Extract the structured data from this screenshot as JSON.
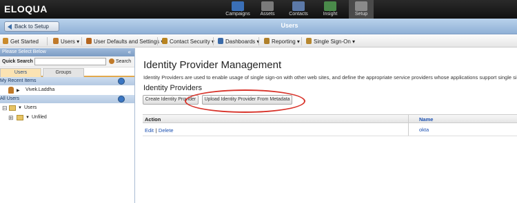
{
  "app": {
    "brand": "ELOQUA"
  },
  "topnav": [
    {
      "label": "Campaigns",
      "color": "#3a6fb7"
    },
    {
      "label": "Assets",
      "color": "#7a7a7a"
    },
    {
      "label": "Contacts",
      "color": "#5c79a8"
    },
    {
      "label": "Insight",
      "color": "#4a8a4a"
    },
    {
      "label": "Setup",
      "color": "#8a8a8a"
    }
  ],
  "titlebar": {
    "back_label": "Back to Setup",
    "title": "Users"
  },
  "menubar": [
    {
      "label": "Get Started",
      "icon": "rocket-icon",
      "color": "#c98a2b"
    },
    {
      "label": "Users ▾",
      "icon": "user-icon",
      "color": "#c07a2a"
    },
    {
      "label": "User Defaults and Settings ▾",
      "icon": "user-gear-icon",
      "color": "#b4651f"
    },
    {
      "label": "Contact Security ▾",
      "icon": "lock-icon",
      "color": "#b8831f"
    },
    {
      "label": "Dashboards ▾",
      "icon": "dashboard-icon",
      "color": "#3a6aa8"
    },
    {
      "label": "Reporting ▾",
      "icon": "report-icon",
      "color": "#b0802a"
    },
    {
      "label": "Single Sign-On ▾",
      "icon": "key-icon",
      "color": "#b7872e"
    }
  ],
  "sidebar": {
    "header": "Please Select Below",
    "collapse": "«",
    "quick_search_label": "Quick Search",
    "search_label": "Search",
    "tabs": [
      "Users",
      "Groups"
    ],
    "recent_title": "My Recent Items",
    "recent_items": [
      "Vivek.Laddha"
    ],
    "all_users_title": "All Users",
    "tree": [
      {
        "label": "Users",
        "expander": "⊟"
      },
      {
        "label": "Unfiled",
        "expander": "⊞"
      }
    ]
  },
  "main": {
    "title": "Identity Provider Management",
    "description": "Identity Providers are used to enable usage of single sign-on with other web sites, and define the appropriate service providers whose applications support single sign-on.",
    "section": "Identity Providers",
    "buttons": {
      "create": "Create Identity Provider",
      "upload": "Upload Identity Provider From Metadata"
    },
    "table": {
      "columns": [
        "Action",
        "Name"
      ],
      "rows": [
        {
          "edit": "Edit",
          "sep": "|",
          "delete": "Delete",
          "name": "okta"
        }
      ]
    }
  },
  "colors": {
    "annotation": "#d8332a",
    "accent": "#e2a94c"
  }
}
